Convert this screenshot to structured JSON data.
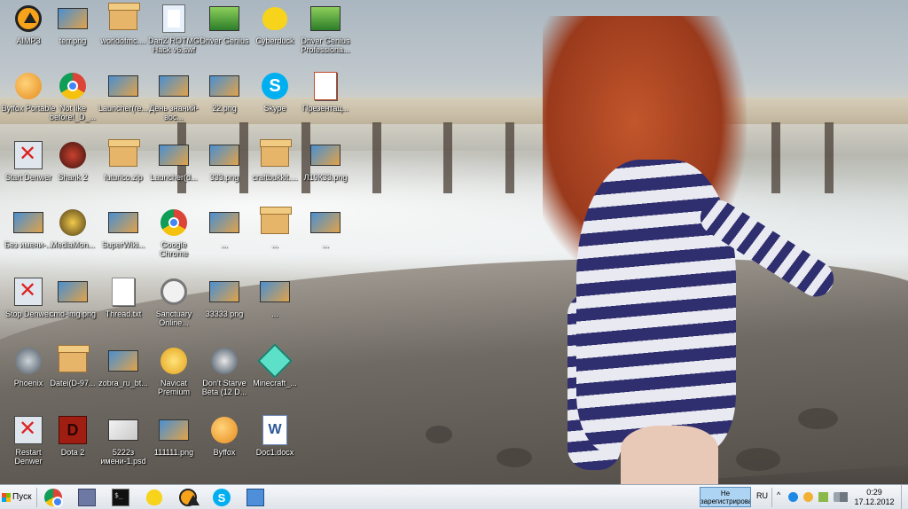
{
  "desktop": {
    "icons": [
      {
        "label": "AIMP3",
        "icon": "aimp-icon"
      },
      {
        "label": "terr.png",
        "icon": "image-file-icon"
      },
      {
        "label": "worldofmc....",
        "icon": "archive-icon"
      },
      {
        "label": "DanZ ROTMG Hack v6.swf",
        "icon": "flash-file-icon"
      },
      {
        "label": "Driver Genius",
        "icon": "driver-genius-icon"
      },
      {
        "label": "Cyberduck",
        "icon": "cyberduck-icon"
      },
      {
        "label": "Driver Genius Professiona...",
        "icon": "driver-genius-icon"
      },
      {
        "label": "Byffox Portable",
        "icon": "byffox-icon"
      },
      {
        "label": "Not like before!_D_...",
        "icon": "chrome-icon"
      },
      {
        "label": "Launcher(re...",
        "icon": "image-file-icon"
      },
      {
        "label": "День знаний-вос...",
        "icon": "image-file-icon"
      },
      {
        "label": "22.png",
        "icon": "image-file-icon"
      },
      {
        "label": "Skype",
        "icon": "skype-icon"
      },
      {
        "label": "Презентац...",
        "icon": "powerpoint-icon"
      },
      {
        "label": "Start Denwer",
        "icon": "denwer-icon"
      },
      {
        "label": "Shank 2",
        "icon": "shank-icon"
      },
      {
        "label": "futurico.zip",
        "icon": "archive-icon"
      },
      {
        "label": "Launcher(d...",
        "icon": "image-file-icon"
      },
      {
        "label": "333.png",
        "icon": "image-file-icon"
      },
      {
        "label": "craftbukkit....",
        "icon": "archive-icon"
      },
      {
        "label": "Л19К33.png",
        "icon": "image-file-icon"
      },
      {
        "label": "Без имени-...",
        "icon": "image-file-icon"
      },
      {
        "label": "MediaMon...",
        "icon": "mediamonkey-icon"
      },
      {
        "label": "SuperWiki...",
        "icon": "image-file-icon"
      },
      {
        "label": "Google Chrome",
        "icon": "chrome-icon"
      },
      {
        "label": "...",
        "icon": "image-file-icon"
      },
      {
        "label": "...",
        "icon": "archive-icon"
      },
      {
        "label": "...",
        "icon": "image-file-icon"
      },
      {
        "label": "Stop Denwer",
        "icon": "denwer-icon"
      },
      {
        "label": "cmd-img.png",
        "icon": "image-file-icon"
      },
      {
        "label": "Thread.txt",
        "icon": "text-file-icon"
      },
      {
        "label": "Sanctuary Online...",
        "icon": "headphones-icon"
      },
      {
        "label": "33333.png",
        "icon": "image-file-icon"
      },
      {
        "label": "...",
        "icon": "image-file-icon"
      },
      {
        "label": "Phoenix",
        "icon": "phoenix-icon"
      },
      {
        "label": "Datei(D-97...",
        "icon": "archive-icon"
      },
      {
        "label": "zobra_ru_bt...",
        "icon": "image-file-icon"
      },
      {
        "label": "Navicat Premium",
        "icon": "navicat-icon"
      },
      {
        "label": "Don't Starve Beta (12 D...",
        "icon": "dont-starve-icon"
      },
      {
        "label": "Minecraft_...",
        "icon": "minecraft-diamond-icon"
      },
      {
        "label": "Restart Denwer",
        "icon": "denwer-icon"
      },
      {
        "label": "Dota 2",
        "icon": "dota2-icon"
      },
      {
        "label": "5222з имени-1.psd",
        "icon": "psd-file-icon"
      },
      {
        "label": "111111.png",
        "icon": "image-file-icon"
      },
      {
        "label": "Byffox",
        "icon": "byffox-icon"
      },
      {
        "label": "Doc1.docx",
        "icon": "word-doc-icon"
      }
    ]
  },
  "taskbar": {
    "start_label": "Пуск",
    "pinned": [
      {
        "name": "chrome",
        "icon": "chrome-icon"
      },
      {
        "name": "storage",
        "icon": "floppy-icon"
      },
      {
        "name": "command-prompt",
        "icon": "terminal-icon"
      },
      {
        "name": "cyberduck",
        "icon": "cyberduck-icon"
      },
      {
        "name": "aimp",
        "icon": "aimp-icon"
      },
      {
        "name": "skype",
        "icon": "skype-icon"
      },
      {
        "name": "network",
        "icon": "network-icon"
      }
    ],
    "notice": "Не зарегистрирован",
    "language": "RU",
    "clock_time": "0:29",
    "clock_date": "17.12.2012"
  },
  "colors": {
    "taskbar_top": "#f5f7fa",
    "taskbar_bottom": "#dfe4ea",
    "notice_bg": "#aed4f3"
  }
}
